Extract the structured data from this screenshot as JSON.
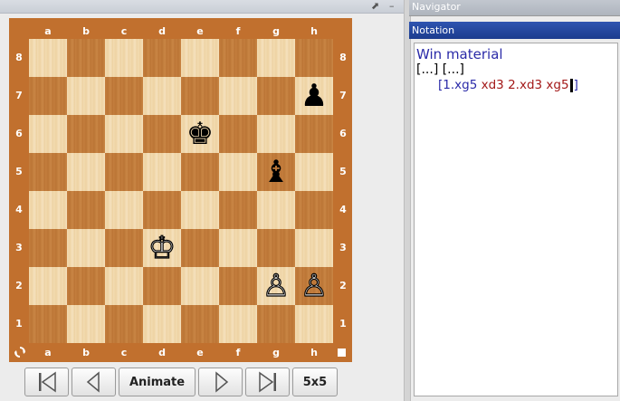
{
  "board": {
    "files": [
      "a",
      "b",
      "c",
      "d",
      "e",
      "f",
      "g",
      "h"
    ],
    "ranks": [
      "8",
      "7",
      "6",
      "5",
      "4",
      "3",
      "2",
      "1"
    ],
    "pieces": [
      {
        "square": "h7",
        "glyph": "♟",
        "color": "black",
        "icon": "black-pawn-icon"
      },
      {
        "square": "e6",
        "glyph": "♚",
        "color": "black",
        "icon": "black-king-icon"
      },
      {
        "square": "g5",
        "glyph": "♝",
        "color": "black",
        "icon": "black-bishop-icon"
      },
      {
        "square": "d3",
        "glyph": "♔",
        "color": "white",
        "icon": "white-king-icon"
      },
      {
        "square": "g2",
        "glyph": "♙",
        "color": "white",
        "icon": "white-pawn-icon"
      },
      {
        "square": "h2",
        "glyph": "♙",
        "color": "white",
        "icon": "white-pawn-icon"
      }
    ],
    "colors": {
      "frame": "#c1702e",
      "light": "#f3dcb2",
      "dark": "#c57f3f"
    }
  },
  "controls": {
    "animate_label": "Animate",
    "size_label": "5x5"
  },
  "navigator": {
    "title": "Navigator"
  },
  "notation": {
    "title": "Notation",
    "heading": "Win material",
    "ellipsis": "[...] [...]",
    "moves": {
      "open": "[1.",
      "m1": "xg5 ",
      "m2": "xd3 ",
      "num2": "2.",
      "m3": "xd3 ",
      "m4": "xg5",
      "close": "]"
    },
    "move_colors": {
      "blue": "#2a2aa8",
      "red": "#a31818"
    }
  }
}
